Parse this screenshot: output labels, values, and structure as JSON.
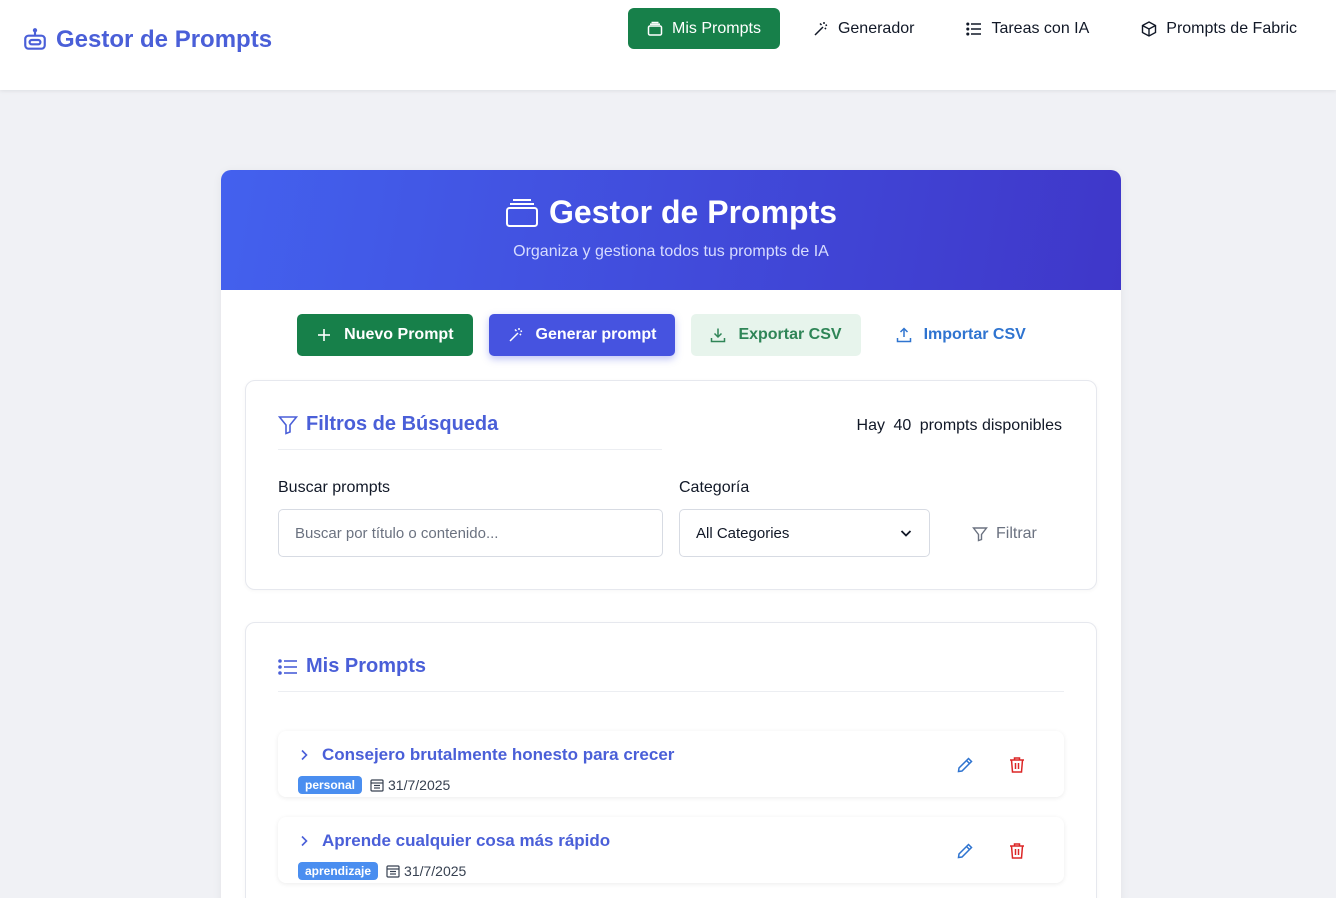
{
  "brand": {
    "title": "Gestor de Prompts"
  },
  "nav": [
    {
      "label": "Mis Prompts",
      "active": true,
      "icon": "stack-icon"
    },
    {
      "label": "Generador",
      "icon": "magic-wand-icon"
    },
    {
      "label": "Tareas con IA",
      "icon": "list-icon"
    },
    {
      "label": "Prompts de Fabric",
      "icon": "box-icon"
    }
  ],
  "hero": {
    "title": "Gestor de Prompts",
    "subtitle": "Organiza y gestiona todos tus prompts de IA"
  },
  "actions": {
    "new": "Nuevo Prompt",
    "generate": "Generar prompt",
    "export": "Exportar CSV",
    "import": "Importar CSV"
  },
  "filters": {
    "title": "Filtros de Búsqueda",
    "count_prefix": "Hay",
    "count": "40",
    "count_suffix": "prompts disponibles",
    "search_label": "Buscar prompts",
    "search_placeholder": "Buscar por título o contenido...",
    "category_label": "Categoría",
    "category_value": "All Categories",
    "filter_button": "Filtrar"
  },
  "list": {
    "title": "Mis Prompts",
    "items": [
      {
        "title": "Consejero brutalmente honesto para crecer",
        "tag": "personal",
        "date": "31/7/2025"
      },
      {
        "title": "Aprende cualquier cosa más rápido",
        "tag": "aprendizaje",
        "date": "31/7/2025"
      }
    ]
  },
  "colors": {
    "primary": "#4a5fd8",
    "green": "#17804a",
    "danger": "#dc2626",
    "badge": "#4a8ef0"
  }
}
